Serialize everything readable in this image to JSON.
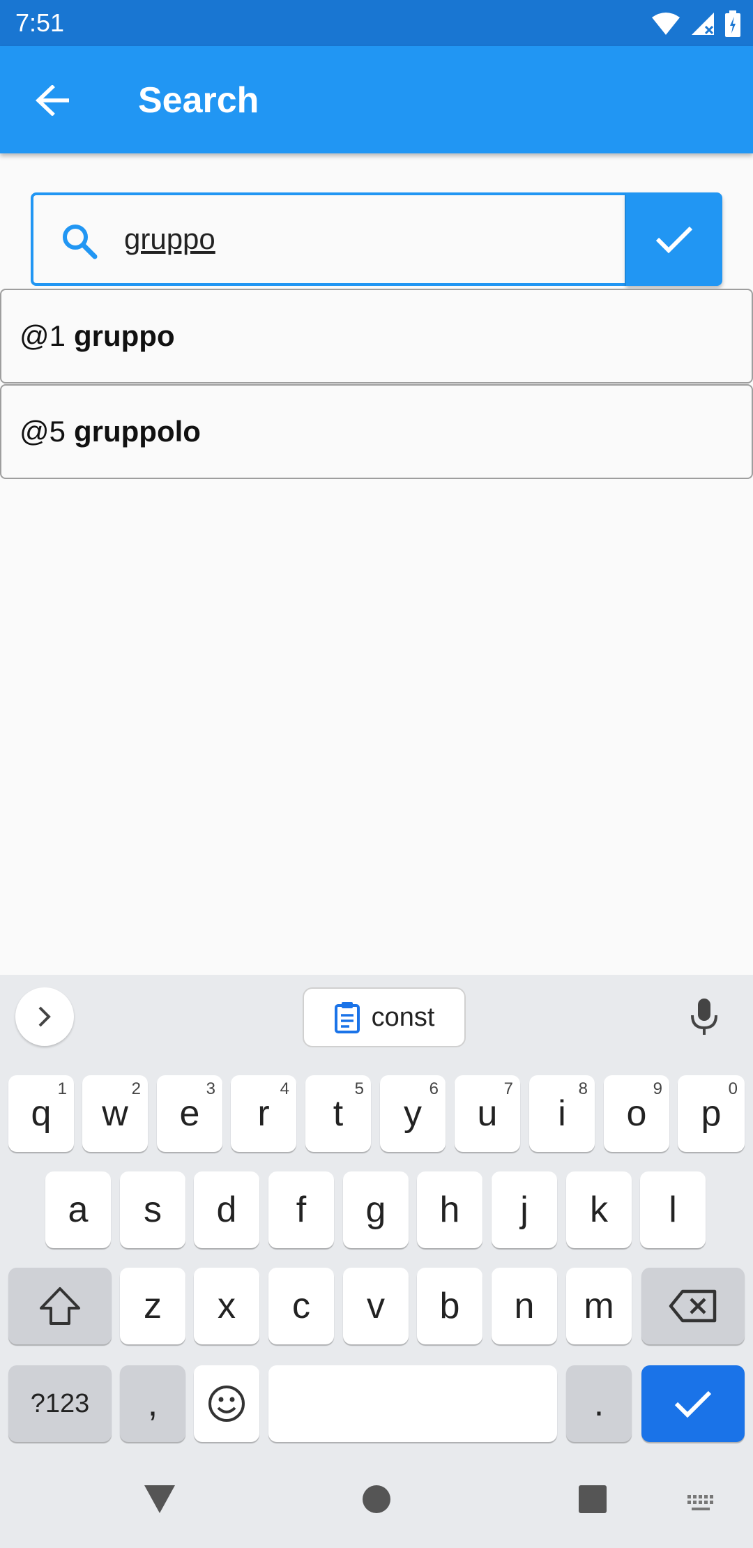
{
  "status_bar": {
    "time": "7:51",
    "icons": [
      "wifi-icon",
      "signal-icon",
      "battery-icon"
    ]
  },
  "app_bar": {
    "title": "Search",
    "back_icon": "arrow-back-icon",
    "color": "#2196f3"
  },
  "search": {
    "value": "gruppo",
    "icon": "search-icon",
    "submit_icon": "check-icon"
  },
  "results": [
    {
      "prefix": "@1",
      "name": "gruppo"
    },
    {
      "prefix": "@5",
      "name": "gruppolo"
    }
  ],
  "keyboard": {
    "suggestion_chip": "const",
    "rows": [
      [
        [
          "q",
          "1"
        ],
        [
          "w",
          "2"
        ],
        [
          "e",
          "3"
        ],
        [
          "r",
          "4"
        ],
        [
          "t",
          "5"
        ],
        [
          "y",
          "6"
        ],
        [
          "u",
          "7"
        ],
        [
          "i",
          "8"
        ],
        [
          "o",
          "9"
        ],
        [
          "p",
          "0"
        ]
      ],
      [
        [
          "a",
          ""
        ],
        [
          "s",
          ""
        ],
        [
          "d",
          ""
        ],
        [
          "f",
          ""
        ],
        [
          "g",
          ""
        ],
        [
          "h",
          ""
        ],
        [
          "j",
          ""
        ],
        [
          "k",
          ""
        ],
        [
          "l",
          ""
        ]
      ],
      [
        [
          "z",
          ""
        ],
        [
          "x",
          ""
        ],
        [
          "c",
          ""
        ],
        [
          "v",
          ""
        ],
        [
          "b",
          ""
        ],
        [
          "n",
          ""
        ],
        [
          "m",
          ""
        ]
      ]
    ],
    "symbols_label": "?123",
    "comma_label": ",",
    "period_label": ".",
    "enter_color": "#1a73e8"
  }
}
